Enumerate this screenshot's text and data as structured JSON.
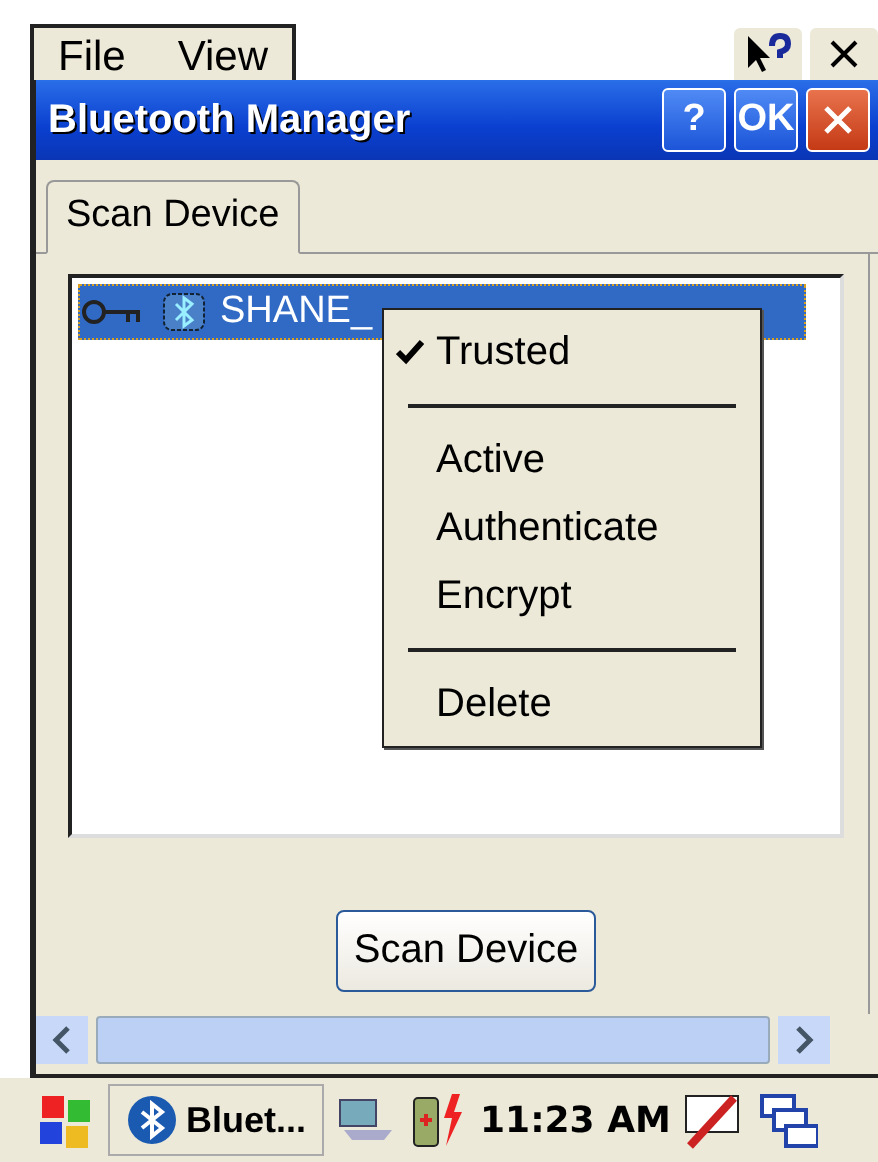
{
  "app_menu": [
    "File",
    "View"
  ],
  "dialog": {
    "title": "Bluetooth Manager",
    "title_buttons": [
      {
        "kind": "help",
        "label": "?"
      },
      {
        "kind": "ok",
        "label": "OK"
      },
      {
        "kind": "close"
      }
    ]
  },
  "tabs": [
    {
      "label": "Scan Device",
      "selected": true
    }
  ],
  "devices": [
    {
      "label": "SHANE_",
      "selected": true
    }
  ],
  "context_menu": [
    {
      "kind": "item",
      "label": "Trusted",
      "checked": true
    },
    {
      "kind": "separator"
    },
    {
      "kind": "item",
      "label": "Active",
      "checked": false
    },
    {
      "kind": "item",
      "label": "Authenticate",
      "checked": false
    },
    {
      "kind": "item",
      "label": "Encrypt",
      "checked": false
    },
    {
      "kind": "separator"
    },
    {
      "kind": "item",
      "label": "Delete",
      "checked": false
    }
  ],
  "scan_button": "Scan Device",
  "taskbar": {
    "task": "Bluet...",
    "time": "11:23 AM"
  }
}
